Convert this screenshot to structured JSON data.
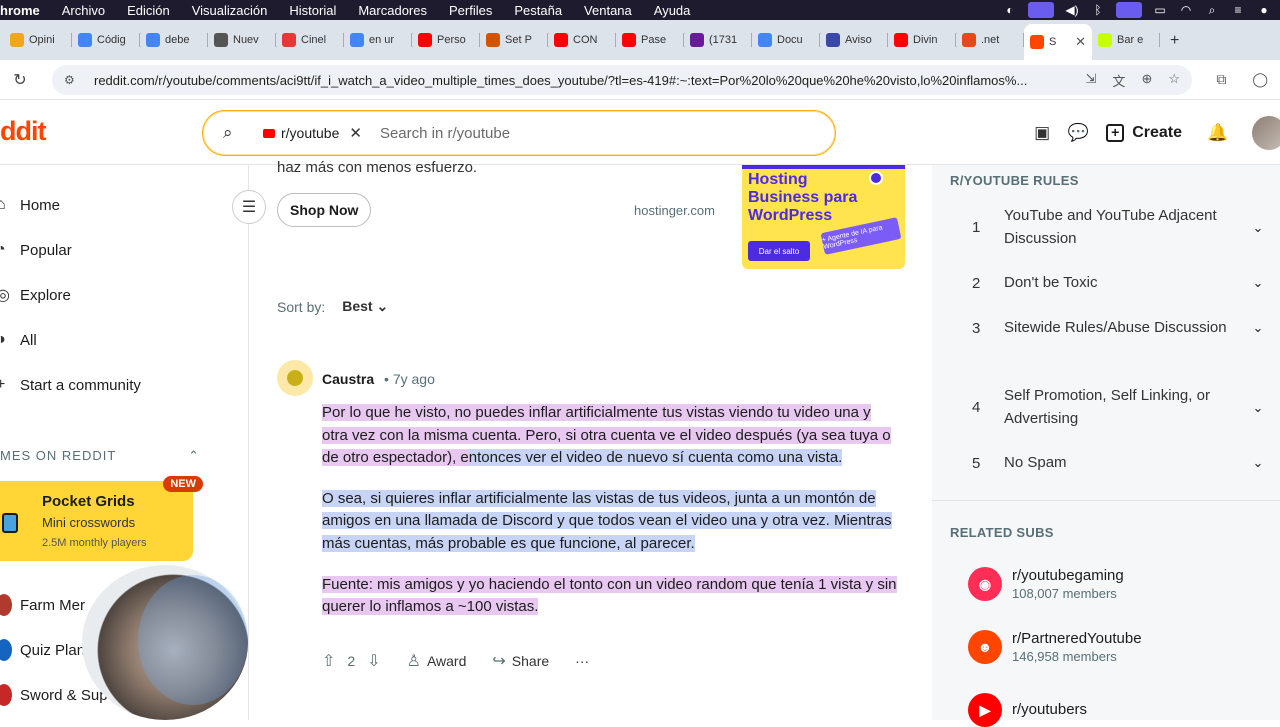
{
  "menubar": {
    "app": "hrome",
    "items": [
      "Archivo",
      "Edición",
      "Visualización",
      "Historial",
      "Marcadores",
      "Perfiles",
      "Pestaña",
      "Ventana",
      "Ayuda"
    ]
  },
  "tabs": [
    {
      "label": "Opini",
      "icon": "favicon-generic",
      "color": "#f2a61c"
    },
    {
      "label": "Códig",
      "icon": "favicon-code",
      "color": "#4285f4"
    },
    {
      "label": "debe",
      "icon": "google-icon",
      "color": "#4285f4"
    },
    {
      "label": "Nuev",
      "icon": "favicon-gear",
      "color": "#555555"
    },
    {
      "label": "Cinel",
      "icon": "favicon-red",
      "color": "#e53935"
    },
    {
      "label": "en ur",
      "icon": "google-icon",
      "color": "#4285f4"
    },
    {
      "label": "Perso",
      "icon": "youtube-icon",
      "color": "#ff0000"
    },
    {
      "label": "Set P",
      "icon": "favicon-pencil",
      "color": "#d35400"
    },
    {
      "label": "CON",
      "icon": "youtube-icon",
      "color": "#ff0000"
    },
    {
      "label": "Pase",
      "icon": "youtube-icon",
      "color": "#ff0000"
    },
    {
      "label": "(1731",
      "icon": "favicon-purple",
      "color": "#6a1b9a"
    },
    {
      "label": "Docu",
      "icon": "docs-icon",
      "color": "#4285f4"
    },
    {
      "label": "Aviso",
      "icon": "favicon-v",
      "color": "#3949ab"
    },
    {
      "label": "Divin",
      "icon": "youtube-icon",
      "color": "#ff0000"
    },
    {
      "label": ".net",
      "icon": "favicon-orange",
      "color": "#e64a19"
    },
    {
      "label": "S",
      "icon": "reddit-icon",
      "color": "#ff4500",
      "active": true
    },
    {
      "label": "Bar e",
      "icon": "favicon-id",
      "color": "#c6ff00"
    }
  ],
  "address": {
    "url": "reddit.com/r/youtube/comments/aci9tt/if_i_watch_a_video_multiple_times_does_youtube/?tl=es-419#:~:text=Por%20lo%20que%20he%20visto,lo%20inflamos%..."
  },
  "header": {
    "logo_text": "ddit",
    "search_chip": "r/youtube",
    "search_placeholder": "Search in r/youtube",
    "create_label": "Create"
  },
  "left_nav": {
    "items": [
      {
        "label": "Home",
        "icon": "home-icon"
      },
      {
        "label": "Popular",
        "icon": "popular-icon"
      },
      {
        "label": "Explore",
        "icon": "explore-icon"
      },
      {
        "label": "All",
        "icon": "all-icon"
      },
      {
        "label": "Start a community",
        "icon": "plus-icon"
      }
    ],
    "games_header": "MES ON REDDIT",
    "promo": {
      "title": "Pocket Grids",
      "subtitle": "Mini crosswords",
      "players": "2.5M monthly players",
      "badge": "NEW"
    },
    "games": [
      {
        "label": "Farm Mer",
        "color": "#b03a2e"
      },
      {
        "label": "Quiz Plane",
        "color": "#1565c0"
      },
      {
        "label": "Sword & Sup",
        "color": "#c62828"
      }
    ]
  },
  "ad": {
    "text": "haz más con menos esfuerzo.",
    "button": "Shop Now",
    "domain": "hostinger.com",
    "image_title": "Hosting Business para WordPress",
    "image_button": "Dar el salto",
    "image_tag": "+ Agente de IA para WordPress"
  },
  "sort": {
    "label": "Sort by:",
    "value": "Best"
  },
  "comment": {
    "author": "Caustra",
    "time": "• 7y ago",
    "p1_a": "Por lo que he visto, no puedes inflar artificialmente tus vistas viendo tu video una y otra vez con la misma cuenta. Pero, si otra cuenta ve el video después (ya sea tuya o de otro espectador), e",
    "p1_b": "ntonces ver el video de nuevo sí cuenta como una vista.",
    "p2": "O sea, si quieres inflar artificialmente las vistas de tus videos, junta a un montón de amigos en una llamada de Discord y que todos vean el video una y otra vez. Mientras más cuentas, más probable es que funcione, al parecer.",
    "p3": "Fuente: mis amigos y yo haciendo el tonto con un video random que tenía 1 vista y sin querer lo inflamos a ~100 vistas.",
    "votes": "2",
    "award": "Award",
    "share": "Share",
    "more": "···"
  },
  "rules": {
    "title": "R/YOUTUBE RULES",
    "items": [
      {
        "n": "1",
        "text": "YouTube and YouTube Adjacent Discussion"
      },
      {
        "n": "2",
        "text": "Don't be Toxic"
      },
      {
        "n": "3",
        "text": "Sitewide Rules/Abuse Discussion"
      },
      {
        "n": "4",
        "text": "Self Promotion, Self Linking, or Advertising"
      },
      {
        "n": "5",
        "text": "No Spam"
      }
    ]
  },
  "related": {
    "title": "RELATED SUBS",
    "items": [
      {
        "name": "r/youtubegaming",
        "members": "108,007 members",
        "color": "#ff2e56"
      },
      {
        "name": "r/PartneredYoutube",
        "members": "146,958 members",
        "color": "#ff4500"
      },
      {
        "name": "r/youtubers",
        "members": "",
        "color": "#ff0000"
      }
    ]
  }
}
